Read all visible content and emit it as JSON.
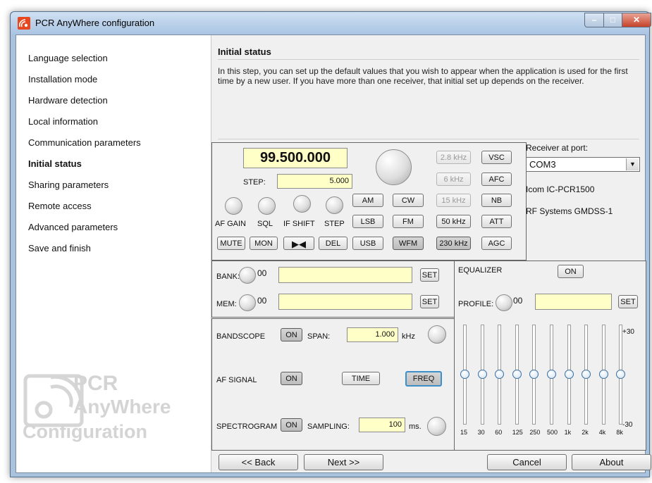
{
  "window": {
    "title": "PCR AnyWhere configuration"
  },
  "nav": {
    "items": [
      {
        "label": "Language selection",
        "active": false
      },
      {
        "label": "Installation mode",
        "active": false
      },
      {
        "label": "Hardware detection",
        "active": false
      },
      {
        "label": "Local information",
        "active": false
      },
      {
        "label": "Communication parameters",
        "active": false
      },
      {
        "label": "Initial status",
        "active": true
      },
      {
        "label": "Sharing parameters",
        "active": false
      },
      {
        "label": "Remote access",
        "active": false
      },
      {
        "label": "Advanced parameters",
        "active": false
      },
      {
        "label": "Save and finish",
        "active": false
      }
    ]
  },
  "logo": {
    "line1": "PCR",
    "line2": "AnyWhere",
    "line3": "Configuration"
  },
  "page": {
    "title": "Initial status",
    "description": "In this step, you can set up the default values that you wish to appear when the application is used for the first time by a new user. If you have more than one receiver, that initial set up depends on the receiver."
  },
  "radio": {
    "frequency": "99.500.000",
    "step_label": "STEP:",
    "step_value": "5.000",
    "knob_labels": [
      "AF GAIN",
      "SQL",
      "IF SHIFT",
      "STEP"
    ],
    "mode_buttons": [
      "AM",
      "CW",
      "LSB",
      "FM",
      "USB",
      "WFM"
    ],
    "filter_buttons": [
      "2.8 kHz",
      "6 kHz",
      "15 kHz",
      "50 kHz",
      "230 kHz"
    ],
    "func_buttons": [
      "VSC",
      "AFC",
      "NB",
      "ATT",
      "AGC"
    ],
    "bottom_buttons": {
      "mute": "MUTE",
      "mon": "MON",
      "del": "DEL"
    }
  },
  "receiver": {
    "label": "Receiver at port:",
    "port": "COM3",
    "model": "Icom IC-PCR1500",
    "system": "RF Systems GMDSS-1"
  },
  "memory": {
    "bank_label": "BANK:",
    "bank_num": "00",
    "mem_label": "MEM:",
    "mem_num": "00",
    "set": "SET"
  },
  "scope": {
    "bandscope": "BANDSCOPE",
    "bandscope_on": "ON",
    "span_label": "SPAN:",
    "span_value": "1.000",
    "span_unit": "kHz",
    "af_signal": "AF SIGNAL",
    "af_on": "ON",
    "time": "TIME",
    "freq": "FREQ",
    "spectrogram": "SPECTROGRAM",
    "spectro_on": "ON",
    "sampling_label": "SAMPLING:",
    "sampling_value": "100",
    "sampling_unit": "ms."
  },
  "equalizer": {
    "label": "EQUALIZER",
    "on": "ON",
    "profile_label": "PROFILE:",
    "profile_num": "00",
    "set": "SET",
    "max_label": "+30",
    "min_label": "-30",
    "bands": [
      "15",
      "30",
      "60",
      "125",
      "250",
      "500",
      "1k",
      "2k",
      "4k",
      "8k"
    ],
    "levels_db": [
      0,
      0,
      0,
      0,
      0,
      0,
      0,
      0,
      0,
      0
    ]
  },
  "footer": {
    "back": "<< Back",
    "next": "Next >>",
    "cancel": "Cancel",
    "about": "About"
  }
}
